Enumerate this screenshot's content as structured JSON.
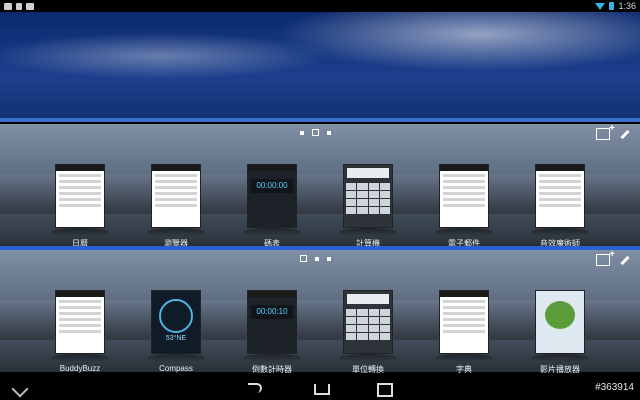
{
  "status_bar": {
    "time": "1:36",
    "icons": [
      "notification-icon",
      "doc-icon",
      "controller-icon",
      "wifi-icon",
      "battery-icon"
    ]
  },
  "sections": [
    {
      "name": "top",
      "pager": [
        "•",
        "□",
        "•"
      ],
      "tiles": [
        {
          "label": "日曆",
          "thumb": "calendar"
        },
        {
          "label": "瀏覽器",
          "thumb": "browser"
        },
        {
          "label": "碼表",
          "thumb": "stopwatch",
          "display": "00:00:00"
        },
        {
          "label": "計算機",
          "thumb": "calculator"
        },
        {
          "label": "電子郵件",
          "thumb": "email"
        },
        {
          "label": "音效魔術師",
          "thumb": "audio"
        }
      ]
    },
    {
      "name": "bottom",
      "pager": [
        "□",
        "•",
        "•"
      ],
      "tiles": [
        {
          "label": "BuddyBuzz",
          "thumb": "buddybuzz"
        },
        {
          "label": "Compass",
          "thumb": "compass",
          "reading": "53°NE"
        },
        {
          "label": "倒數計時器",
          "thumb": "timer",
          "display": "00:00:10"
        },
        {
          "label": "單位轉換",
          "thumb": "converter"
        },
        {
          "label": "字典",
          "thumb": "dictionary"
        },
        {
          "label": "影片播放器",
          "thumb": "video"
        }
      ]
    }
  ],
  "watermark": "#363914",
  "colors": {
    "accent": "#2b5fd4",
    "sky": "#1c3f8d",
    "panel": "#5d6b80"
  }
}
